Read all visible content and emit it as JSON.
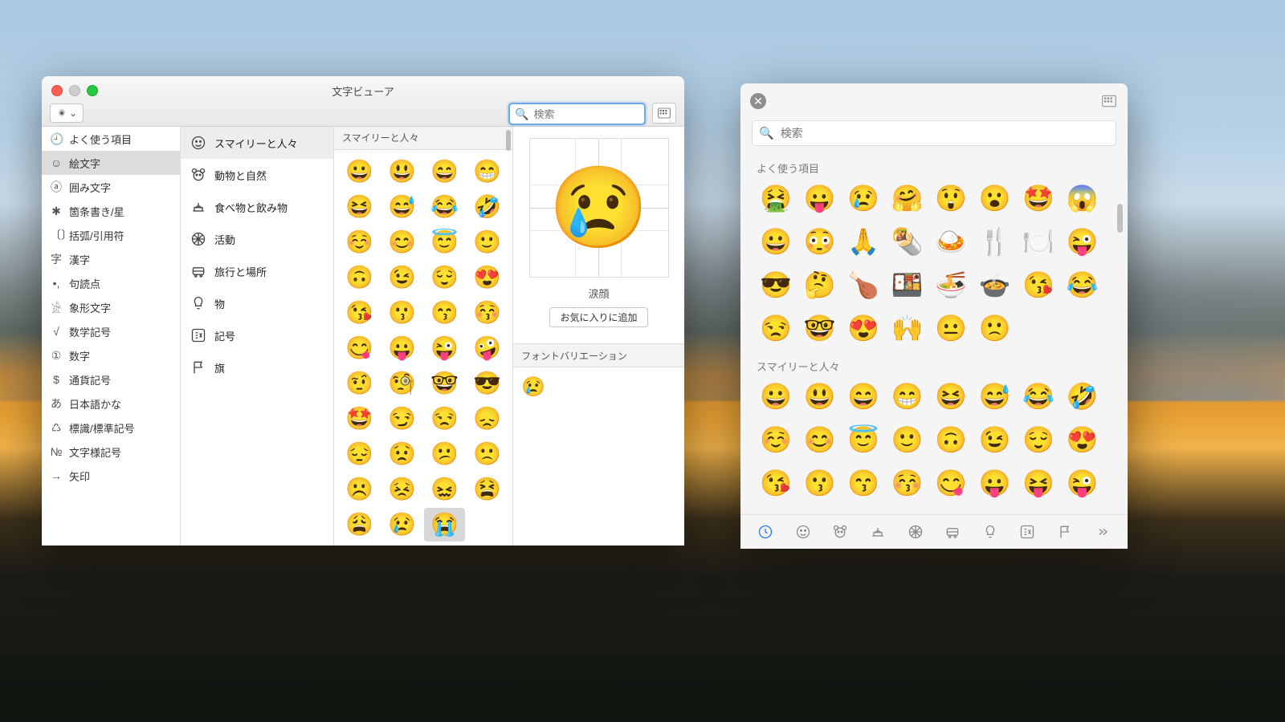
{
  "viewer": {
    "title": "文字ビューア",
    "search_placeholder": "検索",
    "left_items": [
      {
        "icon": "🕘",
        "label": "よく使う項目"
      },
      {
        "icon": "☺",
        "label": "絵文字",
        "selected": true
      },
      {
        "icon": "ⓐ",
        "label": "囲み文字"
      },
      {
        "icon": "✱",
        "label": "箇条書き/星"
      },
      {
        "icon": "〔〕",
        "label": "括弧/引用符"
      },
      {
        "icon": "字",
        "label": "漢字"
      },
      {
        "icon": "•,",
        "label": "句読点"
      },
      {
        "icon": "𓀀",
        "label": "象形文字"
      },
      {
        "icon": "√",
        "label": "数学記号"
      },
      {
        "icon": "①",
        "label": "数字"
      },
      {
        "icon": "$",
        "label": "通貨記号"
      },
      {
        "icon": "あ",
        "label": "日本語かな"
      },
      {
        "icon": "♺",
        "label": "標識/標準記号"
      },
      {
        "icon": "№",
        "label": "文字様記号"
      },
      {
        "icon": "→",
        "label": "矢印"
      }
    ],
    "categories": [
      {
        "key": "smiley",
        "label": "スマイリーと人々",
        "selected": true
      },
      {
        "key": "animal",
        "label": "動物と自然"
      },
      {
        "key": "food",
        "label": "食べ物と飲み物"
      },
      {
        "key": "activity",
        "label": "活動"
      },
      {
        "key": "travel",
        "label": "旅行と場所"
      },
      {
        "key": "objects",
        "label": "物"
      },
      {
        "key": "symbols",
        "label": "記号"
      },
      {
        "key": "flags",
        "label": "旗"
      }
    ],
    "grid_header": "スマイリーと人々",
    "grid": [
      "😀",
      "😃",
      "😄",
      "😁",
      "😆",
      "😅",
      "😂",
      "🤣",
      "☺️",
      "😊",
      "😇",
      "🙂",
      "🙃",
      "😉",
      "😌",
      "😍",
      "😘",
      "😗",
      "😙",
      "😚",
      "😋",
      "😛",
      "😜",
      "🤪",
      "🤨",
      "🧐",
      "🤓",
      "😎",
      "🤩",
      "😏",
      "😒",
      "😞",
      "😔",
      "😟",
      "😕",
      "🙁",
      "☹️",
      "😣",
      "😖",
      "😫",
      "😩",
      "😢",
      "😭"
    ],
    "grid_selected_index": 42,
    "preview_char": "😢",
    "preview_name": "涙顔",
    "favorite_button": "お気に入りに追加",
    "font_variation_label": "フォントバリエーション",
    "font_variation_char": "😢"
  },
  "popover": {
    "search_placeholder": "検索",
    "section1_label": "よく使う項目",
    "section1": [
      "🤮",
      "😛",
      "😢",
      "🤗",
      "😲",
      "😮",
      "🤩",
      "😱",
      "😀",
      "😳",
      "🙏",
      "🌯",
      "🍛",
      "🍴",
      "🍽️",
      "😜",
      "😎",
      "🤔",
      "🍗",
      "🍱",
      "🍜",
      "🍲",
      "😘",
      "😂",
      "😒",
      "🤓",
      "😍",
      "🙌",
      "😐",
      "🙁"
    ],
    "section2_label": "スマイリーと人々",
    "section2": [
      "😀",
      "😃",
      "😄",
      "😁",
      "😆",
      "😅",
      "😂",
      "🤣",
      "☺️",
      "😊",
      "😇",
      "🙂",
      "🙃",
      "😉",
      "😌",
      "😍",
      "😘",
      "😗",
      "😙",
      "😚",
      "😋",
      "😛",
      "😝",
      "😜"
    ],
    "tabs": [
      "clock",
      "smiley",
      "animal",
      "food",
      "activity",
      "travel",
      "objects",
      "symbols",
      "flags",
      "more"
    ]
  }
}
